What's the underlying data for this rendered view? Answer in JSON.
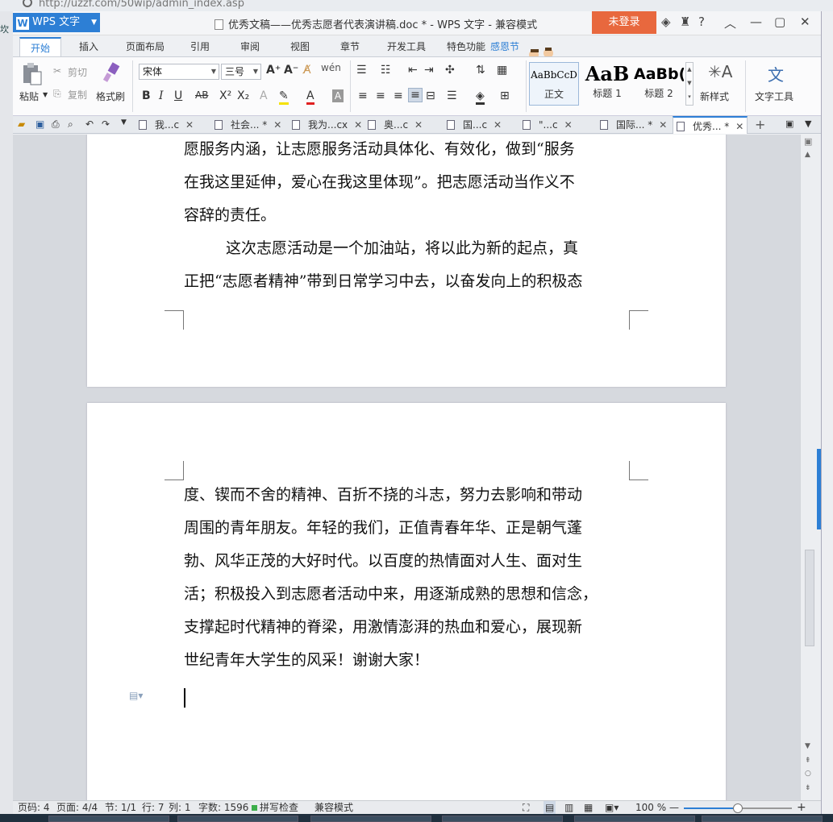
{
  "browser": {
    "url": "http://uzzf.com/50wip/admin_index.asp",
    "left_text": "坎"
  },
  "titlebar": {
    "app_label": "WPS 文字",
    "doc_title": "优秀文稿——优秀志愿者代表演讲稿.doc * - WPS 文字 - 兼容模式",
    "login_label": "未登录"
  },
  "menu": {
    "tabs": [
      "开始",
      "插入",
      "页面布局",
      "引用",
      "审阅",
      "视图",
      "章节",
      "开发工具",
      "特色功能"
    ],
    "deco_text": "感恩节"
  },
  "ribbon": {
    "paste": "粘贴",
    "cut": "剪切",
    "copy": "复制",
    "format_painter": "格式刷",
    "font_name": "宋体",
    "font_size": "三号",
    "styles": [
      {
        "sample": "AaBbCcD",
        "name": "正文"
      },
      {
        "sample": "AaB",
        "name": "标题 1"
      },
      {
        "sample": "AaBb(",
        "name": "标题 2"
      }
    ],
    "new_style": "新样式",
    "text_tools": "文字工具"
  },
  "doc_tabs": [
    {
      "label": "我...c",
      "active": false
    },
    {
      "label": "社会... *",
      "active": false
    },
    {
      "label": "我为...cx",
      "active": false
    },
    {
      "label": "奥...c",
      "active": false
    },
    {
      "label": "国...c",
      "active": false
    },
    {
      "label": "\"...c",
      "active": false
    },
    {
      "label": "国际... *",
      "active": false
    },
    {
      "label": "优秀... *",
      "active": true
    }
  ],
  "document": {
    "page1_lines": [
      "愿服务内涵，让志愿服务活动具体化、有效化，做到“服务",
      "在我这里延伸，爱心在我这里体现”。把志愿活动当作义不",
      "容辞的责任。",
      "这次志愿活动是一个加油站，将以此为新的起点，真",
      "正把“志愿者精神”带到日常学习中去，以奋发向上的积极态"
    ],
    "page2_lines": [
      "度、锲而不舍的精神、百折不挠的斗志，努力去影响和带动",
      "周围的青年朋友。年轻的我们，正值青春年华、正是朝气蓬",
      "勃、风华正茂的大好时代。以百度的热情面对人生、面对生",
      "活；积极投入到志愿者活动中来，用逐渐成熟的思想和信念，",
      "支撑起时代精神的脊梁，用激情澎湃的热血和爱心，展现新",
      "世纪青年大学生的风采！谢谢大家！"
    ]
  },
  "status": {
    "page_code": "页码: 4",
    "pages": "页面: 4/4",
    "section": "节: 1/1",
    "row": "行: 7",
    "col": "列: 1",
    "words": "字数: 1596",
    "spell": "拼写检查",
    "mode": "兼容模式",
    "zoom": "100 %",
    "zoom_fraction": 0.5
  }
}
